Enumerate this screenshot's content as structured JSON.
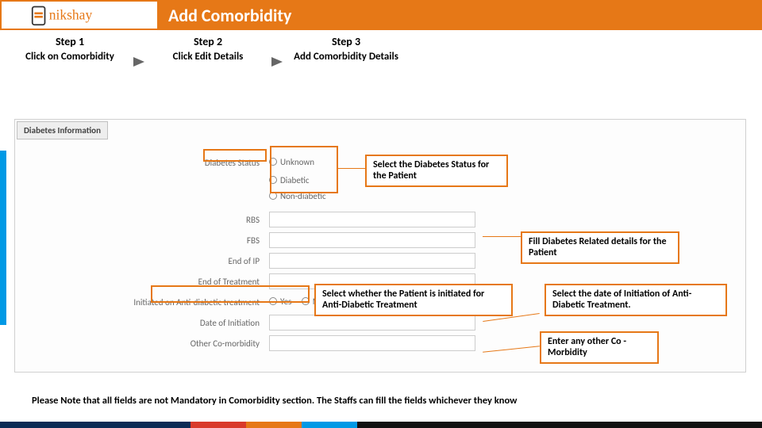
{
  "header": {
    "title": "Add Comorbidity",
    "logo_text": "nikshay"
  },
  "steps": [
    {
      "h": "Step 1",
      "d": "Click on Comorbidity"
    },
    {
      "h": "Step 2",
      "d": "Click Edit Details"
    },
    {
      "h": "Step 3",
      "d": "Add Comorbidity Details"
    }
  ],
  "form": {
    "section": "Diabetes Information",
    "labels": {
      "status": "Diabetes Status",
      "rbs": "RBS",
      "fbs": "FBS",
      "endip": "End of IP",
      "endtrt": "End of Treatment",
      "init": "Initiated on Anti-diabetic treatment",
      "doi": "Date of Initiation",
      "other": "Other Co-morbidity"
    },
    "status_options": [
      "Unknown",
      "Diabetic",
      "Non-diabetic"
    ],
    "yesno": [
      "Yes",
      "No"
    ]
  },
  "callouts": {
    "c1": "Select the Diabetes Status for the Patient",
    "c2": "Fill Diabetes Related details for the Patient",
    "c3": "Select whether the Patient is initiated for Anti-Diabetic Treatment",
    "c4": "Select the date of Initiation of Anti-Diabetic Treatment.",
    "c5": "Enter any other Co -Morbidity"
  },
  "note": "Please Note that all fields are not Mandatory in Comorbidity section. The Staffs can fill the fields whichever they know",
  "colors": {
    "accent": "#e67817",
    "blue": "#0099e5",
    "navy": "#0b2b55",
    "red": "#d93a2b",
    "black": "#111"
  }
}
